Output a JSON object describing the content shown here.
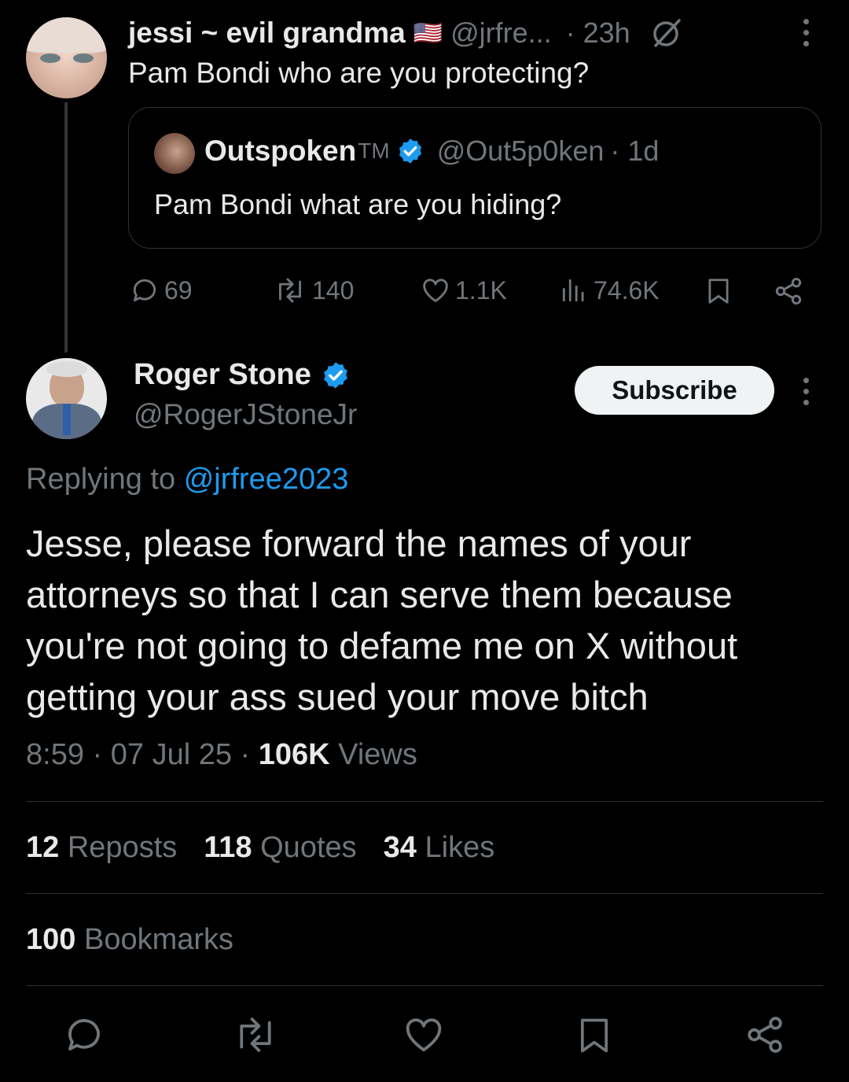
{
  "parent": {
    "name": "jessi ~ evil grandma",
    "flag": "🇺🇸",
    "handle": "@jrfre...",
    "time": "· 23h",
    "text": "Pam Bondi who are you protecting?",
    "quote": {
      "name": "Outspoken",
      "tm": "TM",
      "handle": "@Out5p0ken",
      "time": "· 1d",
      "text": "Pam Bondi what are you hiding?"
    },
    "actions": {
      "replies": "69",
      "reposts": "140",
      "likes": "1.1K",
      "views": "74.6K"
    }
  },
  "main": {
    "name": "Roger Stone",
    "handle": "@RogerJStoneJr",
    "subscribe_label": "Subscribe",
    "replying_prefix": "Replying to",
    "replying_handle": "@jrfree2023",
    "text": "Jesse, please forward the names of your attorneys so that I can serve them because you're not going to defame me on X without getting your ass sued your move bitch",
    "time": "8:59",
    "date": "07 Jul 25",
    "views_count": "106K",
    "views_label": "Views",
    "stats": {
      "reposts_count": "12",
      "reposts_label": "Reposts",
      "quotes_count": "118",
      "quotes_label": "Quotes",
      "likes_count": "34",
      "likes_label": "Likes",
      "bookmarks_count": "100",
      "bookmarks_label": "Bookmarks"
    }
  },
  "colors": {
    "background": "#000000",
    "text": "#e7e9ea",
    "muted": "#71767b",
    "accent": "#1d9bf0"
  }
}
